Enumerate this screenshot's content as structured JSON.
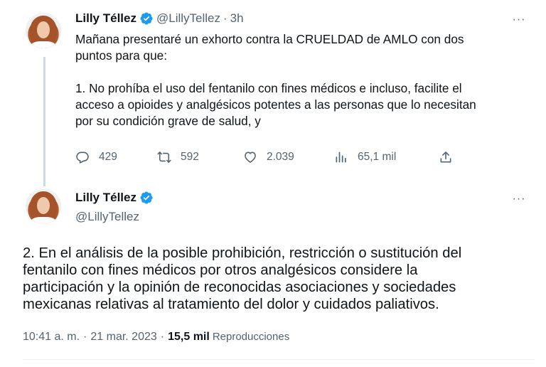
{
  "tweet1": {
    "author": "Lilly Téllez",
    "handle": "@LillyTellez",
    "separator": "·",
    "time": "3h",
    "more": "···",
    "lines": [
      "Mañana presentaré un exhorto contra la CRUELDAD de AMLO con dos",
      "puntos para que:",
      "1. No prohíba el uso del fentanilo con fines médicos e incluso, facilite el",
      "acceso a opioides y analgésicos potentes a las personas que lo necesitan",
      "por su condición grave de salud, y"
    ],
    "replies": "429",
    "retweets": "592",
    "likes": "2.039",
    "views": "65,1 mil",
    "icons": {
      "reply": "reply-icon",
      "retweet": "retweet-icon",
      "like": "heart-icon",
      "views": "views-chart-icon",
      "share": "share-icon"
    }
  },
  "tweet2": {
    "author": "Lilly Téllez",
    "handle": "@LillyTellez",
    "more": "···",
    "lines": [
      "2. En el análisis de la posible prohibición, restricción o sustitución del",
      "fentanilo con fines médicos por otros analgésicos considere la",
      "participación y la opinión de reconocidas asociaciones y sociedades",
      "mexicanas relativas al tratamiento del dolor y cuidados paliativos."
    ],
    "time": "10:41 a. m.",
    "date": "21 mar. 2023",
    "separator": "·",
    "views": "15,5 mil",
    "views_label": "Reproducciones"
  },
  "colors": {
    "text": "#0f1419",
    "secondary": "#536471",
    "verified": "#1d9bf0",
    "thread_line": "#cfd9de"
  }
}
